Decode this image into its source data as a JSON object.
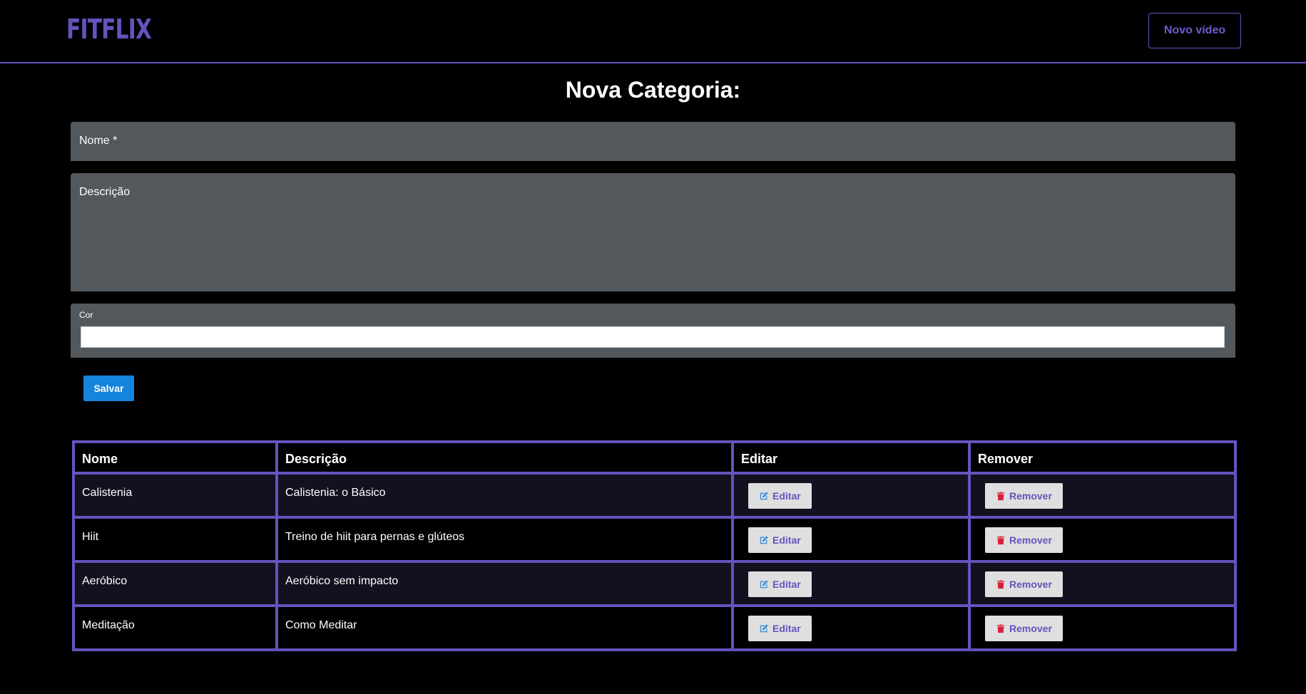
{
  "header": {
    "logo": "FITFLIX",
    "new_video_label": "Novo vídeo"
  },
  "form": {
    "title": "Nova Categoria:",
    "name_label": "Nome *",
    "description_label": "Descrição",
    "color_label": "Cor",
    "save_label": "Salvar"
  },
  "table": {
    "headers": [
      "Nome",
      "Descrição",
      "Editar",
      "Remover"
    ],
    "edit_label": "Editar",
    "remove_label": "Remover",
    "rows": [
      {
        "name": "Calistenia",
        "description": "Calistenia: o Básico"
      },
      {
        "name": "Hiit",
        "description": "Treino de hiit para pernas e glúteos"
      },
      {
        "name": "Aeróbico",
        "description": "Aeróbico sem impacto"
      },
      {
        "name": "Meditação",
        "description": "Como Meditar"
      }
    ]
  },
  "colors": {
    "accent": "#6752bd",
    "field_bg": "#53585c",
    "save_button": "#1584dc",
    "edit_icon": "#3a8fd6",
    "remove_icon": "#d8203a"
  },
  "icons": {
    "edit": "edit-icon",
    "remove": "trash-icon"
  }
}
